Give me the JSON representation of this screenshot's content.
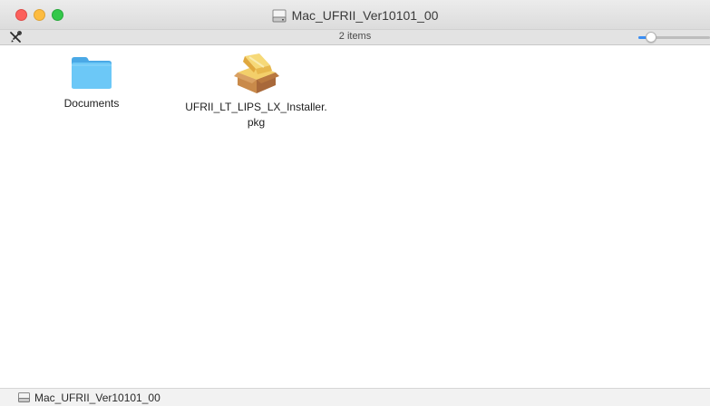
{
  "window": {
    "title": "Mac_UFRII_Ver10101_00",
    "title_icon": "disk-image-icon"
  },
  "toolbar": {
    "action_icon": "tools-icon",
    "items_count": "2 items",
    "icon_size_slider_level": 0.12
  },
  "files": [
    {
      "name_line1": "Documents",
      "name_line2": "",
      "icon": "folder-icon"
    },
    {
      "name_line1": "UFRII_LT_LIPS_LX_Installer.",
      "name_line2": "pkg",
      "icon": "package-icon"
    }
  ],
  "pathbar": {
    "path": "Mac_UFRII_Ver10101_00",
    "icon": "disk-image-icon"
  },
  "colors": {
    "close": "#fc605c",
    "minimize": "#fdbc40",
    "zoom": "#34c84a",
    "accent": "#3b8ef3",
    "folder": "#5ec0f5"
  }
}
